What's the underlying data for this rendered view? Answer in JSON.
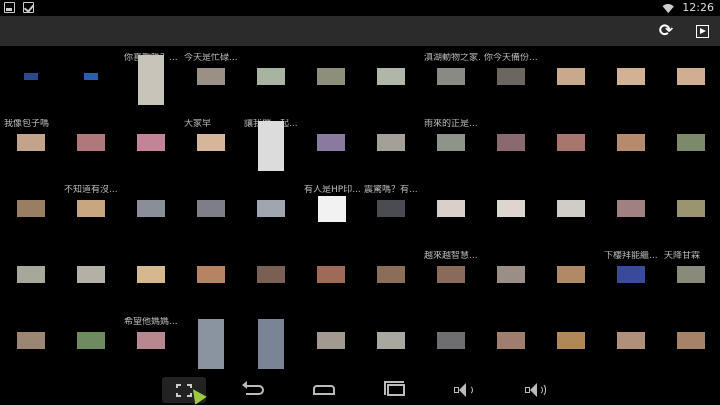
{
  "status_bar": {
    "left_icons": [
      "photo-notification-icon",
      "check-notification-icon"
    ],
    "wifi_icon": "wifi-icon",
    "time": "12:26"
  },
  "action_bar": {
    "refresh_icon": "refresh-icon",
    "slideshow_icon": "slideshow-icon"
  },
  "grid": {
    "rows": [
      [
        {
          "caption": "",
          "thumb": "mini",
          "color": "#2a4a8a"
        },
        {
          "caption": "",
          "thumb": "mini",
          "color": "#2a5fb0"
        },
        {
          "caption": "你喜歡嗎？...",
          "thumb": "portrait",
          "color": "#c8c4ba"
        },
        {
          "caption": "今天是忙碌...",
          "thumb": "landscape",
          "color": "#9a9086"
        },
        {
          "caption": "",
          "thumb": "landscape",
          "color": "#a9b4a0"
        },
        {
          "caption": "",
          "thumb": "landscape",
          "color": "#8d8f7a"
        },
        {
          "caption": "",
          "thumb": "landscape",
          "color": "#b0b6a8"
        },
        {
          "caption": "滇湖動物之家...",
          "thumb": "landscape",
          "color": "#8a8a84"
        },
        {
          "caption": "你今天備份...",
          "thumb": "landscape",
          "color": "#6b665e"
        },
        {
          "caption": "",
          "thumb": "landscape",
          "color": "#c9a98e"
        },
        {
          "caption": "",
          "thumb": "landscape",
          "color": "#d2b294"
        },
        {
          "caption": "",
          "thumb": "landscape",
          "color": "#cfae92"
        }
      ],
      [
        {
          "caption": "我像包子嗎",
          "thumb": "landscape",
          "color": "#c3a48a"
        },
        {
          "caption": "",
          "thumb": "landscape",
          "color": "#b0787a"
        },
        {
          "caption": "",
          "thumb": "landscape",
          "color": "#c28496"
        },
        {
          "caption": "大家早",
          "thumb": "landscape",
          "color": "#d6b69a"
        },
        {
          "caption": "讓我們一起...",
          "thumb": "portrait",
          "color": "#dcdcdc"
        },
        {
          "caption": "",
          "thumb": "landscape",
          "color": "#8a7aa0"
        },
        {
          "caption": "",
          "thumb": "landscape",
          "color": "#a4a098"
        },
        {
          "caption": "雨來的正是...",
          "thumb": "landscape",
          "color": "#8e9488"
        },
        {
          "caption": "",
          "thumb": "landscape",
          "color": "#8a6a70"
        },
        {
          "caption": "",
          "thumb": "landscape",
          "color": "#a8766e"
        },
        {
          "caption": "",
          "thumb": "landscape",
          "color": "#b78a6e"
        },
        {
          "caption": "",
          "thumb": "landscape",
          "color": "#7a8a6a"
        }
      ],
      [
        {
          "caption": "",
          "thumb": "landscape",
          "color": "#9a7e62"
        },
        {
          "caption": "不知道有沒...",
          "thumb": "landscape",
          "color": "#c8a680"
        },
        {
          "caption": "",
          "thumb": "landscape",
          "color": "#8a8e98"
        },
        {
          "caption": "",
          "thumb": "landscape",
          "color": "#7e7f86"
        },
        {
          "caption": "",
          "thumb": "landscape",
          "color": "#a0a6b0"
        },
        {
          "caption": "有人是HP印...",
          "thumb": "square",
          "color": "#f2f2f2"
        },
        {
          "caption": "震驚嗎？有...",
          "thumb": "landscape",
          "color": "#4a4c52"
        },
        {
          "caption": "",
          "thumb": "landscape",
          "color": "#d8d0ca"
        },
        {
          "caption": "",
          "thumb": "landscape",
          "color": "#ddd6ce"
        },
        {
          "caption": "",
          "thumb": "landscape",
          "color": "#d0ccc8"
        },
        {
          "caption": "",
          "thumb": "landscape",
          "color": "#a08080"
        },
        {
          "caption": "",
          "thumb": "landscape",
          "color": "#9a9470"
        }
      ],
      [
        {
          "caption": "",
          "thumb": "landscape",
          "color": "#a8a89a"
        },
        {
          "caption": "",
          "thumb": "landscape",
          "color": "#b4b0a6"
        },
        {
          "caption": "",
          "thumb": "landscape",
          "color": "#d6b88e"
        },
        {
          "caption": "",
          "thumb": "landscape",
          "color": "#b68462"
        },
        {
          "caption": "",
          "thumb": "landscape",
          "color": "#7a6052"
        },
        {
          "caption": "",
          "thumb": "landscape",
          "color": "#a06a58"
        },
        {
          "caption": "",
          "thumb": "landscape",
          "color": "#8a6e5a"
        },
        {
          "caption": "越來越智慧...",
          "thumb": "landscape",
          "color": "#8a6a5a"
        },
        {
          "caption": "",
          "thumb": "landscape",
          "color": "#9a8e86"
        },
        {
          "caption": "",
          "thumb": "landscape",
          "color": "#b08a66"
        },
        {
          "caption": "下樓拜能繼...",
          "thumb": "landscape",
          "color": "#3a4a9a"
        },
        {
          "caption": "天降甘霖",
          "thumb": "landscape",
          "color": "#8a8a7a"
        }
      ],
      [
        {
          "caption": "",
          "thumb": "landscape",
          "color": "#9a8672"
        },
        {
          "caption": "",
          "thumb": "landscape",
          "color": "#6e8a5e"
        },
        {
          "caption": "希望他媽媽...",
          "thumb": "landscape",
          "color": "#b88890"
        },
        {
          "caption": "",
          "thumb": "portrait",
          "color": "#8a94a0"
        },
        {
          "caption": "",
          "thumb": "portrait",
          "color": "#7a8494"
        },
        {
          "caption": "",
          "thumb": "landscape",
          "color": "#a09a90"
        },
        {
          "caption": "",
          "thumb": "landscape",
          "color": "#a8a89e"
        },
        {
          "caption": "",
          "thumb": "landscape",
          "color": "#6e6e70"
        },
        {
          "caption": "",
          "thumb": "landscape",
          "color": "#a07e6e"
        },
        {
          "caption": "",
          "thumb": "landscape",
          "color": "#b08858"
        },
        {
          "caption": "",
          "thumb": "landscape",
          "color": "#b0907a"
        },
        {
          "caption": "",
          "thumb": "landscape",
          "color": "#a68268"
        }
      ]
    ]
  },
  "nav_bar": {
    "buttons": [
      {
        "name": "screenshot-button",
        "icon": "screenshot-icon",
        "active": true
      },
      {
        "name": "back-button",
        "icon": "back-icon",
        "active": false
      },
      {
        "name": "home-button",
        "icon": "home-icon",
        "active": false
      },
      {
        "name": "recent-apps-button",
        "icon": "recent-apps-icon",
        "active": false
      },
      {
        "name": "volume-down-button",
        "icon": "volume-down-icon",
        "active": false
      },
      {
        "name": "volume-up-button",
        "icon": "volume-up-icon",
        "active": false
      }
    ]
  }
}
